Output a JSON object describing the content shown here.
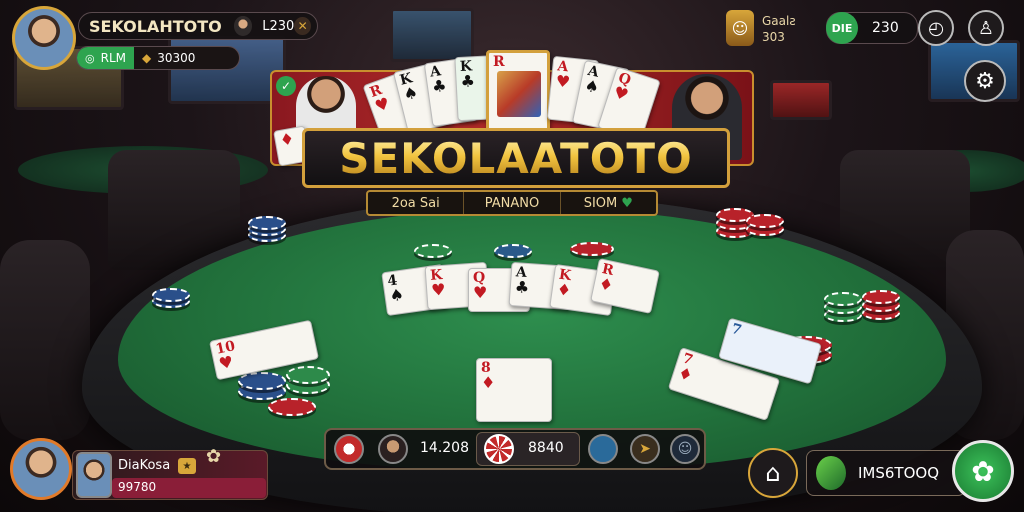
{
  "top_left": {
    "brand": "SEKOLAHTOTO",
    "value_1": "L230",
    "currency_label": "RLM",
    "currency_value": "30300"
  },
  "top_center": {
    "badge_line1": "Gaalƨ",
    "badge_line2": "303"
  },
  "top_right": {
    "status_badge": "DIE",
    "value": "230"
  },
  "banner": {
    "logo": "SEKOLAATOTO",
    "sub_items": [
      "2oa Sai",
      "PANANO",
      "SIOM"
    ]
  },
  "bottom_left": {
    "player_name": "DiaKosa",
    "player_value": "99780"
  },
  "bottom_bar": {
    "amount": "14.208",
    "pot": "8840"
  },
  "bottom_right": {
    "label": "IMS6TOOQ"
  },
  "table_cards": [
    {
      "rank": "4",
      "suit": "♠"
    },
    {
      "rank": "K",
      "suit": "♥"
    },
    {
      "rank": "Q",
      "suit": "♥"
    },
    {
      "rank": "A",
      "suit": "♣"
    },
    {
      "rank": "K",
      "suit": "♦"
    },
    {
      "rank": "R",
      "suit": "♦"
    }
  ],
  "icons": {
    "settings": "gear-icon",
    "home": "home-icon",
    "speed": "gauge-icon",
    "profile": "person-icon",
    "close": "close-icon",
    "chip": "chip-icon"
  },
  "colors": {
    "gold": "#d8a63a",
    "felt": "#21703b",
    "accent_red": "#b02a28",
    "accent_green": "#2ea44f"
  }
}
